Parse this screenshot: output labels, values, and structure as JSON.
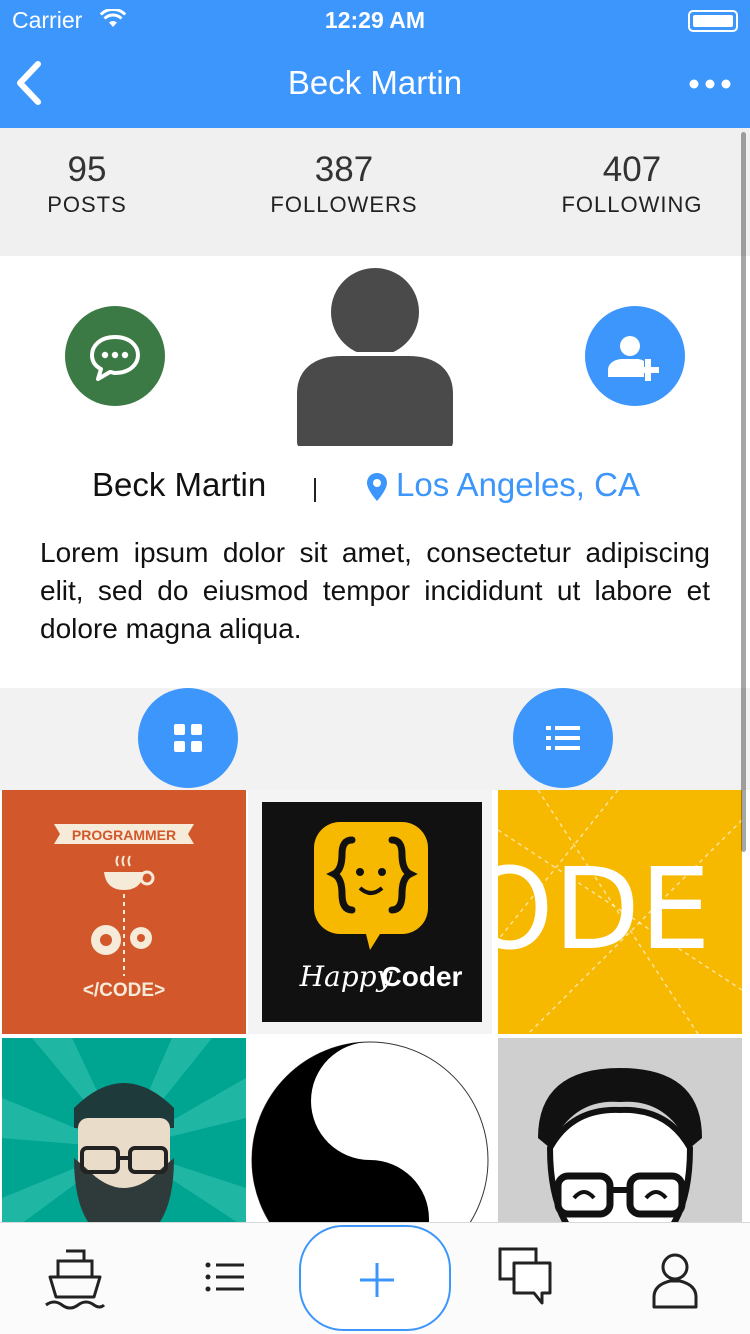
{
  "status_bar": {
    "carrier": "Carrier",
    "time": "12:29 AM"
  },
  "nav": {
    "title": "Beck Martin",
    "back_icon": "chevron-left-icon",
    "more_icon": "more-icon"
  },
  "stats": [
    {
      "value": "95",
      "label": "POSTS"
    },
    {
      "value": "387",
      "label": "FOLLOWERS"
    },
    {
      "value": "407",
      "label": "FOLLOWING"
    }
  ],
  "profile": {
    "name": "Beck Martin",
    "location": "Los Angeles, CA",
    "bio": "Lorem ipsum dolor sit amet, consectetur adipiscing elit, sed do eiusmod tempor incididunt ut labore et dolore magna aliqua."
  },
  "tiles": [
    {
      "title": "PROGRAMMER",
      "caption": "</CODE>",
      "bg": "#d2572a"
    },
    {
      "title": "Happy",
      "caption": "Coder",
      "bg": "#111111"
    },
    {
      "title": "ODE",
      "bg": "#f7b800"
    },
    {
      "bg": "#00a592"
    },
    {
      "top": "0",
      "bottom": "1",
      "bg": "#ffffff"
    },
    {
      "bg": "#cfcfcf"
    }
  ],
  "colors": {
    "primary": "#3d96fb",
    "chat_green": "#3c7a45",
    "stats_bg": "#f0f0f0"
  },
  "tabs": [
    "ship-icon",
    "list-icon",
    "plus-icon",
    "chat-icon",
    "user-icon"
  ]
}
